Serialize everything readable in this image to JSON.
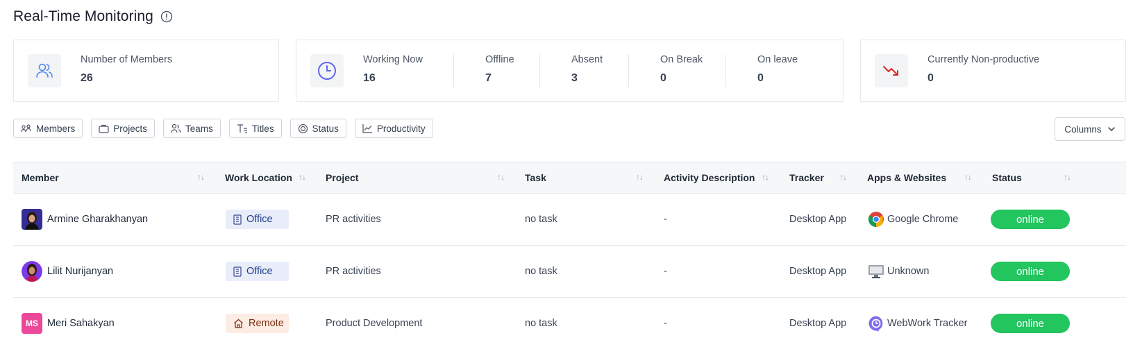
{
  "header": {
    "title": "Real-Time Monitoring",
    "info_icon": "info-circle-icon"
  },
  "summary": {
    "members": {
      "label": "Number of Members",
      "value": "26",
      "icon": "users-icon"
    },
    "working_now": {
      "label": "Working Now",
      "value": "16",
      "icon": "clock-icon"
    },
    "offline": {
      "label": "Offline",
      "value": "7"
    },
    "absent": {
      "label": "Absent",
      "value": "3"
    },
    "on_break": {
      "label": "On Break",
      "value": "0"
    },
    "on_leave": {
      "label": "On leave",
      "value": "0"
    },
    "non_productive": {
      "label": "Currently Non-productive",
      "value": "0",
      "icon": "trend-down-icon"
    }
  },
  "filters": {
    "members": "Members",
    "projects": "Projects",
    "teams": "Teams",
    "titles": "Titles",
    "status": "Status",
    "productivity": "Productivity"
  },
  "columns_button": "Columns",
  "colors": {
    "accent_blue": "#4f86f7",
    "online_green": "#22c55e",
    "clock_purple": "#6366f1",
    "trend_red": "#dc2626"
  },
  "table": {
    "headers": {
      "member": "Member",
      "work_location": "Work Location",
      "project": "Project",
      "task": "Task",
      "activity": "Activity Description",
      "tracker": "Tracker",
      "apps": "Apps & Websites",
      "status": "Status"
    },
    "rows": [
      {
        "member": "Armine Gharakhanyan",
        "avatar": "photo",
        "location": "Office",
        "project": "PR activities",
        "task": "no task",
        "activity": "-",
        "tracker": "Desktop App",
        "app": "Google Chrome",
        "app_icon": "chrome-icon",
        "status": "online"
      },
      {
        "member": "Lilit Nurijanyan",
        "avatar": "photo",
        "location": "Office",
        "project": "PR activities",
        "task": "no task",
        "activity": "-",
        "tracker": "Desktop App",
        "app": "Unknown",
        "app_icon": "monitor-icon",
        "status": "online"
      },
      {
        "member": "Meri Sahakyan",
        "avatar_initials": "MS",
        "location": "Remote",
        "project": "Product Development",
        "task": "no task",
        "activity": "-",
        "tracker": "Desktop App",
        "app": "WebWork Tracker",
        "app_icon": "webwork-icon",
        "status": "online"
      }
    ]
  }
}
